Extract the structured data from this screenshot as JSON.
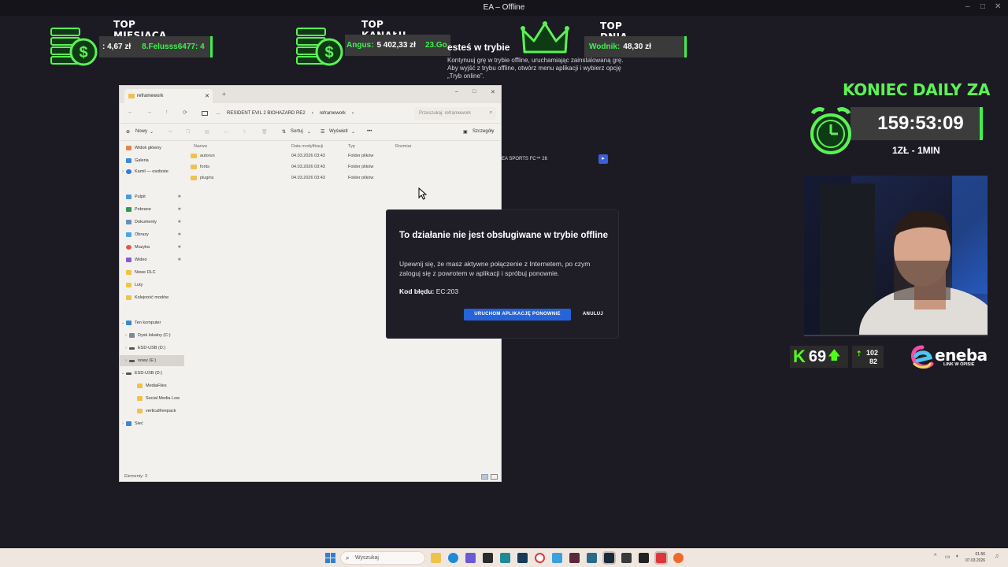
{
  "ea_window": {
    "title": "EA – Offline",
    "minimize": "–",
    "maximize": "□",
    "close": "✕"
  },
  "overlay": {
    "top_month": {
      "heading": "TOP MIESIĄCA",
      "amount": ": 4,67 zł",
      "donor": "8.Felusss6477: 4"
    },
    "top_channel": {
      "heading": "TOP KANAŁU",
      "donor": "Angus:",
      "amount": "5 402,33 zł",
      "extra": "23.Go"
    },
    "top_day": {
      "heading": "TOP DNIA",
      "donor": "Wodnik:",
      "amount": "48,30 zł"
    },
    "daily_title": "KONIEC DAILY ZA",
    "timer": "159:53:09",
    "rate": "1ZŁ - 1MIN",
    "kick": {
      "letter": "K",
      "count": "69",
      "arrow": "🡅"
    },
    "subs": {
      "top": "102",
      "bottom": "82"
    },
    "eneba": {
      "logo": "eneba",
      "sub": "LINK W OPISIE"
    },
    "accent_color": "#3df24b"
  },
  "ea_background": {
    "offline_title": "esteś w trybie",
    "offline_body": "Kontynuuj grę w trybie offline, uruchamiając zainstalowaną grę. Aby wyjść z trybu offline, otwórz menu aplikacji i wybierz opcję „Tryb online”.",
    "game_row": "EA SPORTS FC™ 26",
    "play_icon": "play-icon"
  },
  "explorer": {
    "tab_label": "reframework",
    "tab_close": "✕",
    "new_tab": "+",
    "window_controls": {
      "min": "–",
      "max": "□",
      "close": "✕"
    },
    "nav_back": "←",
    "nav_forward": "→",
    "nav_up": "↑",
    "nav_refresh": "⟳",
    "breadcrumb": [
      "…",
      "RESIDENT EVIL 2 BIOHAZARD RE2",
      "›",
      "reframework",
      "›"
    ],
    "search_placeholder": "Przeszukaj: reframework",
    "toolbar": {
      "new": "Nowy",
      "new_chev": "⌄",
      "sort": "Sortuj",
      "sort_chev": "⌄",
      "view": "Wyświetl",
      "view_chev": "⌄",
      "more": "•••",
      "details": "Szczegóły"
    },
    "nav_pane": {
      "home": "Widok główny",
      "gallery": "Galeria",
      "onedrive": "Kamil — osobiste",
      "desktop": "Pulpit",
      "downloads": "Pobrane",
      "documents": "Dokumenty",
      "pictures": "Obrazy",
      "music": "Muzyka",
      "videos": "Wideo",
      "new_dlc": "Nowe DLC",
      "luty": "Luty",
      "mod_order": "Kolejność modów",
      "this_pc": "Ten komputer",
      "local_disk": "Dysk lokalny (C:)",
      "esd_usb_d": "ESD-USB (D:)",
      "nowy_e": "nowy (E:)",
      "esd_usb_d2": "ESD-USB (D:)",
      "media_files": "MediaFiles",
      "social_media": "Social Media Low",
      "vertical_pack": "verticalfreepack",
      "network": "Sieć"
    },
    "columns": {
      "name": "Nazwa",
      "modified": "Data modyfikacji",
      "type": "Typ",
      "size": "Rozmiar"
    },
    "files": [
      {
        "name": "autorun",
        "modified": "04.03.2026 03:43",
        "type": "Folder plików"
      },
      {
        "name": "fonts",
        "modified": "04.03.2026 03:43",
        "type": "Folder plików"
      },
      {
        "name": "plugins",
        "modified": "04.03.2026 03:43",
        "type": "Folder plików"
      }
    ],
    "status": "Elementy: 3"
  },
  "dialog": {
    "title": "To działanie nie jest obsługiwane w trybie offline",
    "body": "Upewnij się, że masz aktywne połączenie z Internetem, po czym zaloguj się z powrotem w aplikacji i spróbuj ponownie.",
    "code_label": "Kod błędu:",
    "code_value": "EC:203",
    "primary_button": "URUCHOM APLIKACJĘ PONOWNIE",
    "cancel_button": "ANULUJ",
    "primary_color": "#2563d9"
  },
  "taskbar": {
    "search_placeholder": "Wyszukaj",
    "tray_chevron": "^",
    "clock_time": "01:56",
    "clock_date": "07.03.2026"
  }
}
